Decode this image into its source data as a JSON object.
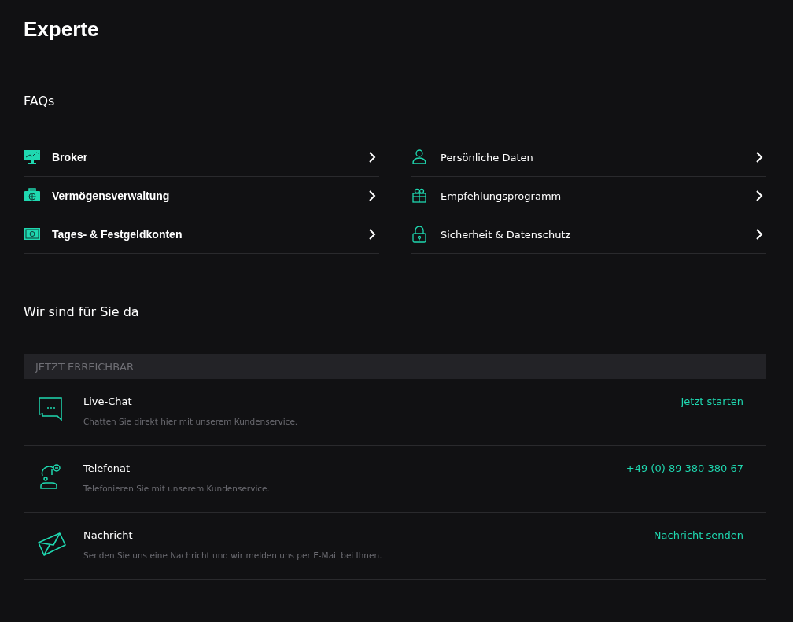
{
  "title": "Experte",
  "faq": {
    "heading": "FAQs",
    "columns": [
      [
        {
          "label": "Broker"
        },
        {
          "label": "Vermögensverwaltung"
        },
        {
          "label": "Tages- & Festgeldkonten"
        }
      ],
      [
        {
          "label": "Persönliche Daten"
        },
        {
          "label": "Empfehlungsprogramm"
        },
        {
          "label": "Sicherheit & Datenschutz"
        }
      ]
    ]
  },
  "contact": {
    "heading": "Wir sind für Sie da",
    "bar_label": "JETZT ERREICHBAR",
    "items": [
      {
        "kind": "chat",
        "title": "Live-Chat",
        "description": "Chatten Sie direkt hier mit unserem Kundenservice.",
        "action": "Jetzt starten"
      },
      {
        "kind": "phone",
        "title": "Telefonat",
        "description": "Telefonieren Sie mit unserem Kundenservice.",
        "action": "+49 (0) 89 380 380 67"
      },
      {
        "kind": "mail",
        "title": "Nachricht",
        "description": "Senden Sie uns eine Nachricht und wir melden uns per E-Mail bei Ihnen.",
        "action": "Nachricht senden"
      }
    ]
  }
}
